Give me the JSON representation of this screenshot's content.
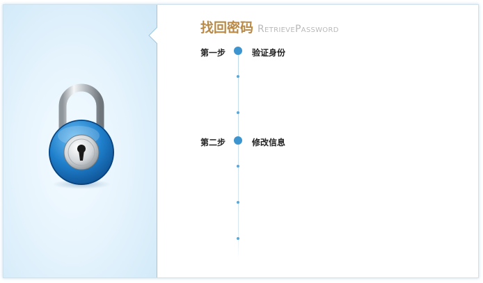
{
  "header": {
    "title_cn": "找回密码",
    "title_en": "RetrievePassword"
  },
  "steps": [
    {
      "number_label": "第一步",
      "name": "验证身份"
    },
    {
      "number_label": "第二步",
      "name": "修改信息"
    }
  ],
  "icons": {
    "hero": "padlock-icon"
  },
  "colors": {
    "title_accent": "#b98a45",
    "subtitle": "#b9b9b9",
    "step_dot": "#3d95cf",
    "panel_border": "#9cc7e0"
  }
}
